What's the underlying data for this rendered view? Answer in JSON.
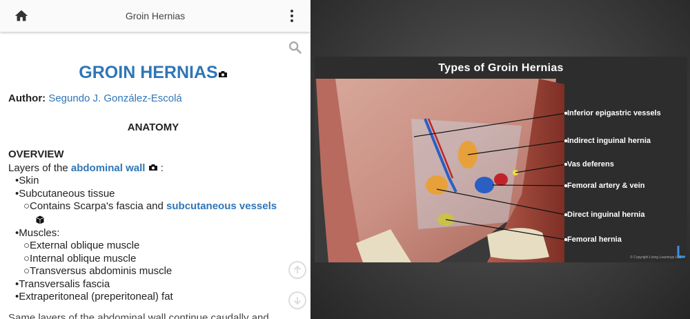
{
  "appbar": {
    "title": "Groin Hernias"
  },
  "icons": {
    "home": "home-icon",
    "menu": "more-vert-icon",
    "search": "search-icon",
    "camera": "camera-icon",
    "cube": "cube-icon",
    "up": "arrow-up-circle-icon",
    "down": "arrow-down-circle-icon"
  },
  "doc": {
    "title": "GROIN HERNIAS",
    "author_label": "Author:",
    "author_name": "Segundo J. González-Escolá",
    "section": "ANATOMY",
    "overview_heading": "OVERVIEW",
    "layers_prefix": "Layers of the ",
    "layers_link": "abdominal wall",
    "layers_suffix": " :",
    "items": {
      "skin": "•Skin",
      "subcut": "•Subcutaneous tissue",
      "scarpa_prefix": "○Contains Scarpa's fascia and ",
      "scarpa_link": "subcutaneous vessels",
      "muscles": "•Muscles:",
      "ext": "○External oblique muscle",
      "int": "○Internal oblique muscle",
      "trans_ab": "○Transversus abdominis muscle",
      "trans_f": "•Transversalis fascia",
      "extraperitoneal": "•Extraperitoneal (preperitoneal) fat"
    },
    "cut_line": "Same layers of the abdominal wall continue caudally and"
  },
  "colors": {
    "link": "#2f76b7",
    "appbar_bg": "#fafafa",
    "viewer_bg": "#3e3e3e"
  },
  "slide": {
    "title": "Types of Groin Hernias",
    "labels": {
      "l1": "Inferior epigastric vessels",
      "l2": "Indirect inguinal hernia",
      "l3": "Vas deferens",
      "l4": "Femoral artery & vein",
      "l5": "Direct inguinal hernia",
      "l6": "Femoral hernia"
    },
    "copyright": "© Copyright Living Learnings LLC"
  }
}
